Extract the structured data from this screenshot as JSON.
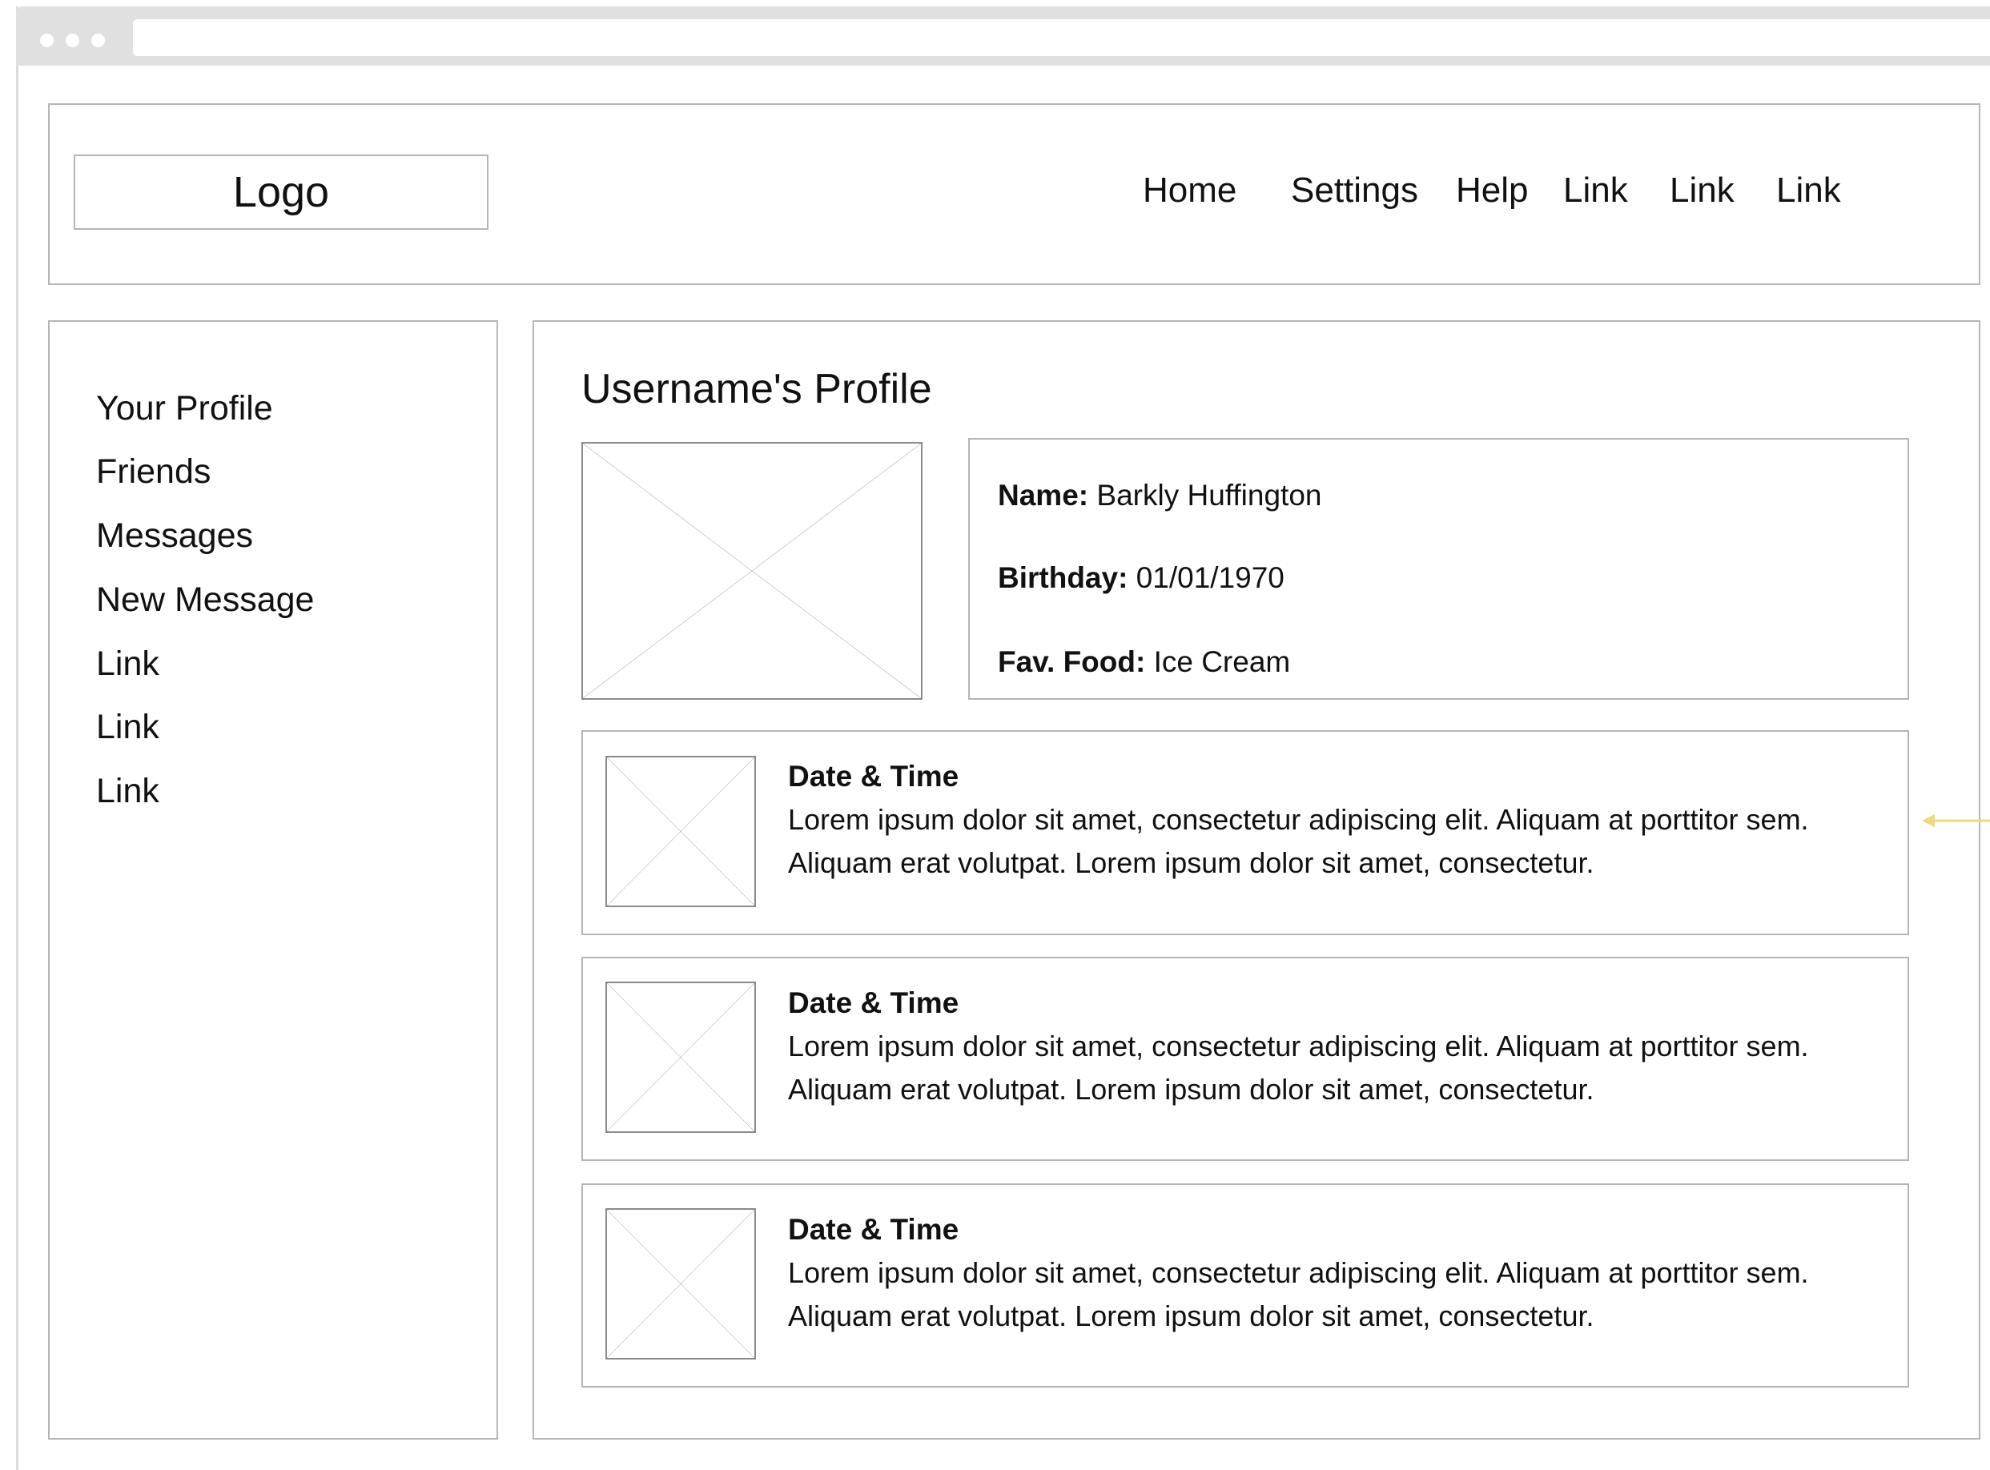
{
  "header": {
    "logo": "Logo",
    "nav": [
      "Home",
      "Settings",
      "Help",
      "Link",
      "Link",
      "Link"
    ]
  },
  "sidebar": {
    "items": [
      "Your Profile",
      "Friends",
      "Messages",
      "New Message",
      "Link",
      "Link",
      "Link"
    ]
  },
  "profile": {
    "title": "Username's Profile",
    "image_icon": "image-placeholder-icon",
    "fields": [
      {
        "label": "Name:",
        "value": "Barkly Huffington"
      },
      {
        "label": "Birthday:",
        "value": "01/01/1970"
      },
      {
        "label": "Fav. Food:",
        "value": "Ice Cream"
      }
    ]
  },
  "posts": [
    {
      "title": "Date & Time",
      "line1": "Lorem ipsum dolor sit amet, consectetur adipiscing elit. Aliquam at porttitor sem.",
      "line2": "Aliquam erat volutpat. Lorem ipsum dolor sit amet, consectetur."
    },
    {
      "title": "Date & Time",
      "line1": "Lorem ipsum dolor sit amet, consectetur adipiscing elit. Aliquam at porttitor sem.",
      "line2": "Aliquam erat volutpat. Lorem ipsum dolor sit amet, consectetur."
    },
    {
      "title": "Date & Time",
      "line1": "Lorem ipsum dolor sit amet, consectetur adipiscing elit. Aliquam at porttitor sem.",
      "line2": "Aliquam erat volutpat. Lorem ipsum dolor sit amet, consectetur."
    }
  ],
  "colors": {
    "border": "#b5b5b5",
    "chrome": "#e0e0e0",
    "annotation_arrow": "#f2d77a"
  }
}
